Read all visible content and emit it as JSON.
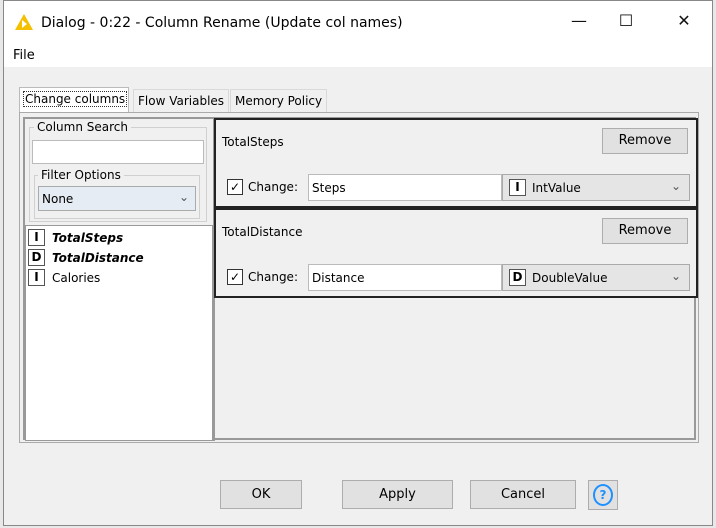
{
  "window": {
    "title": "Dialog - 0:22 - Column Rename (Update col names)",
    "minimize": "—",
    "maximize": "☐",
    "close": "✕"
  },
  "menu": {
    "file": "File"
  },
  "tabs": [
    {
      "label": "Change columns"
    },
    {
      "label": "Flow Variables"
    },
    {
      "label": "Memory Policy"
    }
  ],
  "left": {
    "search_label": "Column Search",
    "search_value": "",
    "filter_label": "Filter Options",
    "filter_value": "None",
    "columns": [
      {
        "type": "I",
        "name": "TotalSteps",
        "bold": true
      },
      {
        "type": "D",
        "name": "TotalDistance",
        "bold": true
      },
      {
        "type": "I",
        "name": "Calories",
        "bold": false
      }
    ]
  },
  "cards": [
    {
      "title": "TotalSteps",
      "remove": "Remove",
      "change_label": "Change:",
      "checked": true,
      "new_name": "Steps",
      "type_badge": "I",
      "type": "IntValue"
    },
    {
      "title": "TotalDistance",
      "remove": "Remove",
      "change_label": "Change:",
      "checked": true,
      "new_name": "Distance",
      "type_badge": "D",
      "type": "DoubleValue"
    }
  ],
  "buttons": {
    "ok": "OK",
    "apply": "Apply",
    "cancel": "Cancel",
    "help": "?"
  },
  "colors": {
    "warning_icon": "#f5c000",
    "help": "#1e90ff"
  }
}
